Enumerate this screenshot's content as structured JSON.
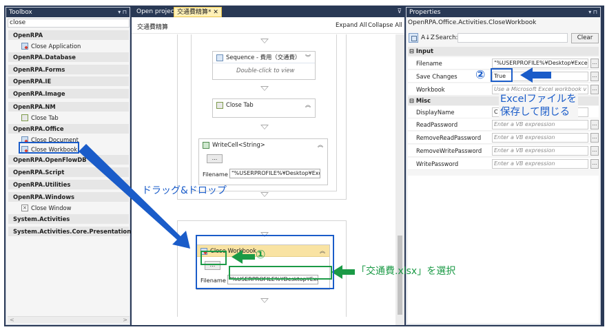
{
  "toolbox": {
    "title": "Toolbox",
    "controls": "▾ ⊓",
    "search_value": "close",
    "categories": [
      {
        "label": "OpenRPA"
      },
      {
        "label": "OpenRPA.Database"
      },
      {
        "label": "OpenRPA.Forms"
      },
      {
        "label": "OpenRPA.IE"
      },
      {
        "label": "OpenRPA.Image"
      },
      {
        "label": "OpenRPA.NM"
      },
      {
        "label": "OpenRPA.Office"
      },
      {
        "label": "OpenRPA.OpenFlowDB"
      },
      {
        "label": "OpenRPA.Script"
      },
      {
        "label": "OpenRPA.Utilities"
      },
      {
        "label": "OpenRPA.Windows"
      },
      {
        "label": "System.Activities"
      },
      {
        "label": "System.Activities.Core.Presentation"
      }
    ],
    "items": {
      "close_application": "Close Application",
      "close_tab": "Close Tab",
      "close_document": "Close Document",
      "close_workbook": "Close Workbook",
      "close_window": "Close Window"
    },
    "hscroll_left": "<",
    "hscroll_right": ">"
  },
  "designer": {
    "tab_open_project": "Open project",
    "tab_active": "交通費精算*",
    "tab_close": "✕",
    "tab_menu": "⊽",
    "breadcrumb": "交通費精算",
    "expand_all": "Expand All",
    "collapse_all": "Collapse All",
    "sequence_title": "Sequence - 費用（交通費）",
    "sequence_hint": "Double-click to view",
    "close_tab_title": "Close Tab",
    "writecell_title": "WriteCell<String>",
    "writecell_dots": "...",
    "writecell_filename_label": "Filename",
    "writecell_filename_value": "\"%USERPROFILE%¥Desktop¥Exc",
    "closewb_title": "Close Workbook",
    "closewb_dots": "...",
    "closewb_filename_label": "Filename",
    "closewb_filename_value": "\"%USERPROFILE%¥Desktop¥Exc",
    "collapse_glyph": "︽",
    "expand_glyph": "︾"
  },
  "properties": {
    "title": "Properties",
    "controls": "▾ ⊓",
    "type_name": "OpenRPA.Office.Activities.CloseWorkbook",
    "sort_az": "A↓Z",
    "search_label": "Search:",
    "clear_label": "Clear",
    "group_input": "⊟ Input",
    "group_misc": "⊟ Misc",
    "rows": [
      {
        "name": "Filename",
        "value": "\"%USERPROFILE%¥Desktop¥Exce",
        "placeholder": false
      },
      {
        "name": "Save Changes",
        "value": "True",
        "placeholder": false
      },
      {
        "name": "Workbook",
        "value": "Use a Microsoft Excel workbook v",
        "placeholder": true
      },
      {
        "name": "DisplayName",
        "value": "C",
        "placeholder": false
      },
      {
        "name": "ReadPassword",
        "value": "Enter a VB expression",
        "placeholder": true
      },
      {
        "name": "RemoveReadPassword",
        "value": "Enter a VB expression",
        "placeholder": true
      },
      {
        "name": "RemoveWritePassword",
        "value": "Enter a VB expression",
        "placeholder": true
      },
      {
        "name": "WritePassword",
        "value": "Enter a VB expression",
        "placeholder": true
      }
    ],
    "row_button": "..."
  },
  "annotations": {
    "drag_drop": "ドラッグ&ドロップ",
    "step1": "①",
    "step2": "②",
    "select_file": "「交通費.xlsx」を選択",
    "excel_close_line1": "Excelファイルを",
    "excel_close_line2": "保存して閉じる"
  },
  "colors": {
    "title_bar": "#293955",
    "annotation_blue": "#1a5cc9",
    "annotation_green": "#1b9a46",
    "active_tab": "#fff1b7",
    "activity_header": "#eef3fa",
    "close_workbook_header": "#f9e3a3"
  }
}
